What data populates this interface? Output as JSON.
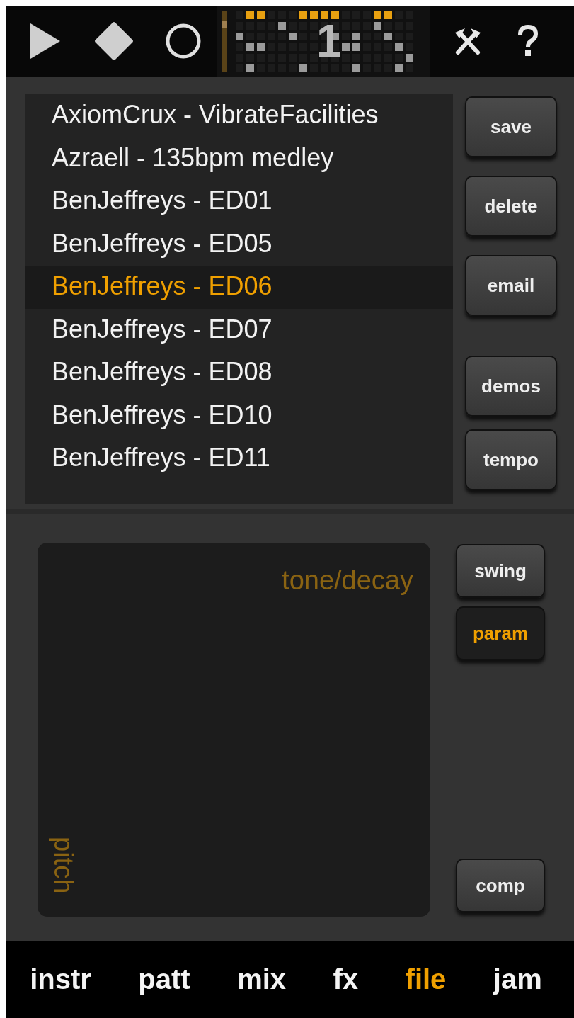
{
  "transport": {
    "pattern_number": "1"
  },
  "file_list": [
    {
      "name": "AxiomCrux - VibrateFacilities",
      "selected": false
    },
    {
      "name": "Azraell - 135bpm medley",
      "selected": false
    },
    {
      "name": "BenJeffreys - ED01",
      "selected": false
    },
    {
      "name": "BenJeffreys - ED05",
      "selected": false
    },
    {
      "name": "BenJeffreys - ED06",
      "selected": true
    },
    {
      "name": "BenJeffreys - ED07",
      "selected": false
    },
    {
      "name": "BenJeffreys - ED08",
      "selected": false
    },
    {
      "name": "BenJeffreys - ED10",
      "selected": false
    },
    {
      "name": "BenJeffreys - ED11",
      "selected": false
    }
  ],
  "file_buttons": [
    {
      "label": "save"
    },
    {
      "label": "delete"
    },
    {
      "label": "email"
    },
    {
      "label": "demos"
    },
    {
      "label": "tempo"
    }
  ],
  "xy_pad": {
    "x_label": "tone/decay",
    "y_label": "pitch"
  },
  "pad_buttons": [
    {
      "label": "swing",
      "selected": false
    },
    {
      "label": "param",
      "selected": true
    },
    {
      "label": "comp",
      "selected": false
    }
  ],
  "tabs": [
    {
      "label": "instr",
      "selected": false
    },
    {
      "label": "patt",
      "selected": false
    },
    {
      "label": "mix",
      "selected": false
    },
    {
      "label": "fx",
      "selected": false
    },
    {
      "label": "file",
      "selected": true
    },
    {
      "label": "jam",
      "selected": false
    }
  ]
}
